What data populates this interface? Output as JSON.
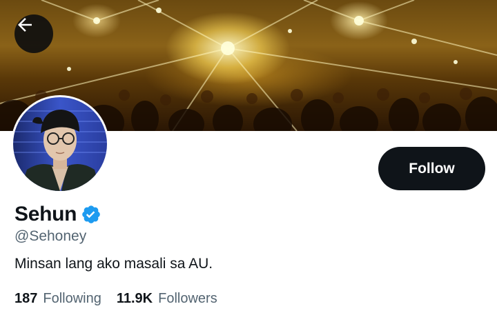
{
  "header": {
    "back_icon": "arrow-left-icon"
  },
  "profile": {
    "display_name": "Sehun",
    "verified_icon": "verified-badge-icon",
    "verified_color": "#1d9bf0",
    "handle": "@Sehoney",
    "bio": "Minsan lang ako masali sa AU.",
    "follow_label": "Follow"
  },
  "stats": {
    "following_count": "187",
    "following_label": "Following",
    "followers_count": "11.9K",
    "followers_label": "Followers"
  },
  "colors": {
    "primary_text": "#0f1419",
    "secondary_text": "#536471",
    "button_bg": "#0f1419",
    "button_text": "#ffffff"
  }
}
